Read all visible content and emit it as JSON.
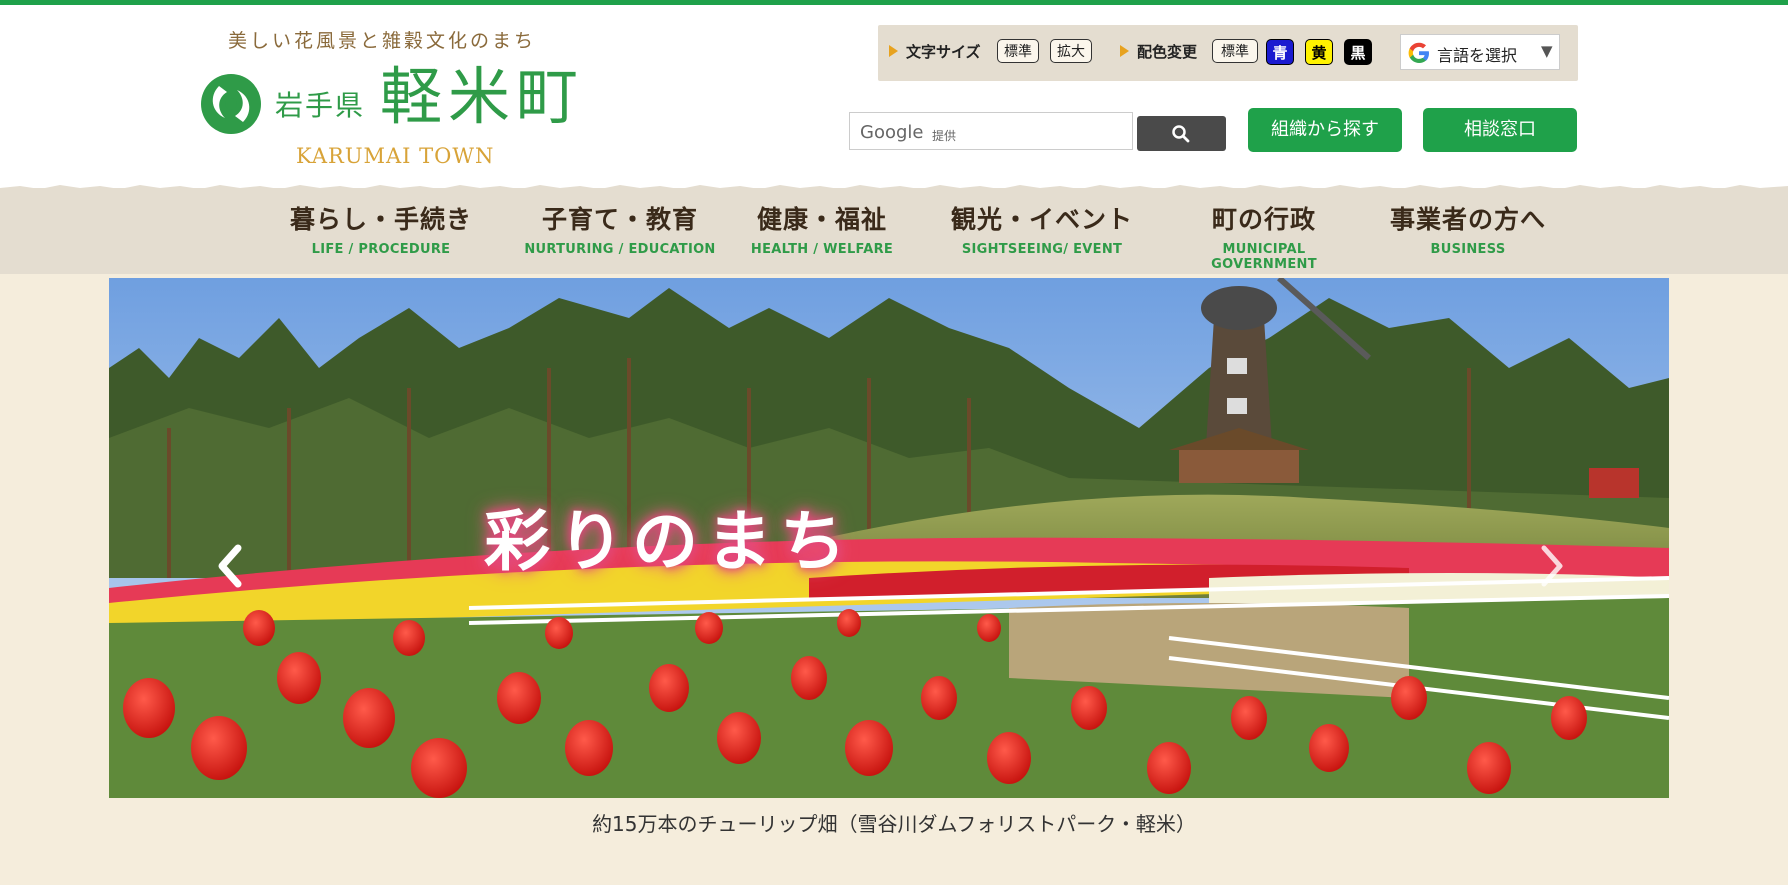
{
  "site": {
    "tagline": "美しい花風景と雑穀文化のまち",
    "prefecture": "岩手県",
    "town": "軽米町",
    "town_en": "KARUMAI TOWN"
  },
  "accessibility": {
    "text_size_label": "文字サイズ",
    "text_size_standard": "標準",
    "text_size_large": "拡大",
    "color_label": "配色変更",
    "color_standard": "標準",
    "color_blue": "青",
    "color_yellow": "黄",
    "color_black": "黒",
    "translate_label": "言語を選択",
    "translate_arrow": "▼"
  },
  "search": {
    "brand": "Google",
    "provided": "提供"
  },
  "header_buttons": {
    "org": "組織から探す",
    "consult": "相談窓口"
  },
  "nav": [
    {
      "jp": "暮らし・手続き",
      "en": "LIFE / PROCEDURE"
    },
    {
      "jp": "子育て・教育",
      "en": "NURTURING / EDUCATION"
    },
    {
      "jp": "健康・福祉",
      "en": "HEALTH / WELFARE"
    },
    {
      "jp": "観光・イベント",
      "en": "SIGHTSEEING/ EVENT"
    },
    {
      "jp": "町の行政",
      "en": "MUNICIPAL GOVERNMENT"
    },
    {
      "jp": "事業者の方へ",
      "en": "BUSINESS"
    }
  ],
  "hero": {
    "title": "彩りのまち",
    "caption": "約15万本のチューリップ畑（雪谷川ダムフォリストパーク・軽米）"
  },
  "colors": {
    "brand_green": "#1fa14a",
    "nav_bg": "#e4ddd0",
    "page_bg": "#f5eddc",
    "accent_orange": "#e7a21f"
  }
}
